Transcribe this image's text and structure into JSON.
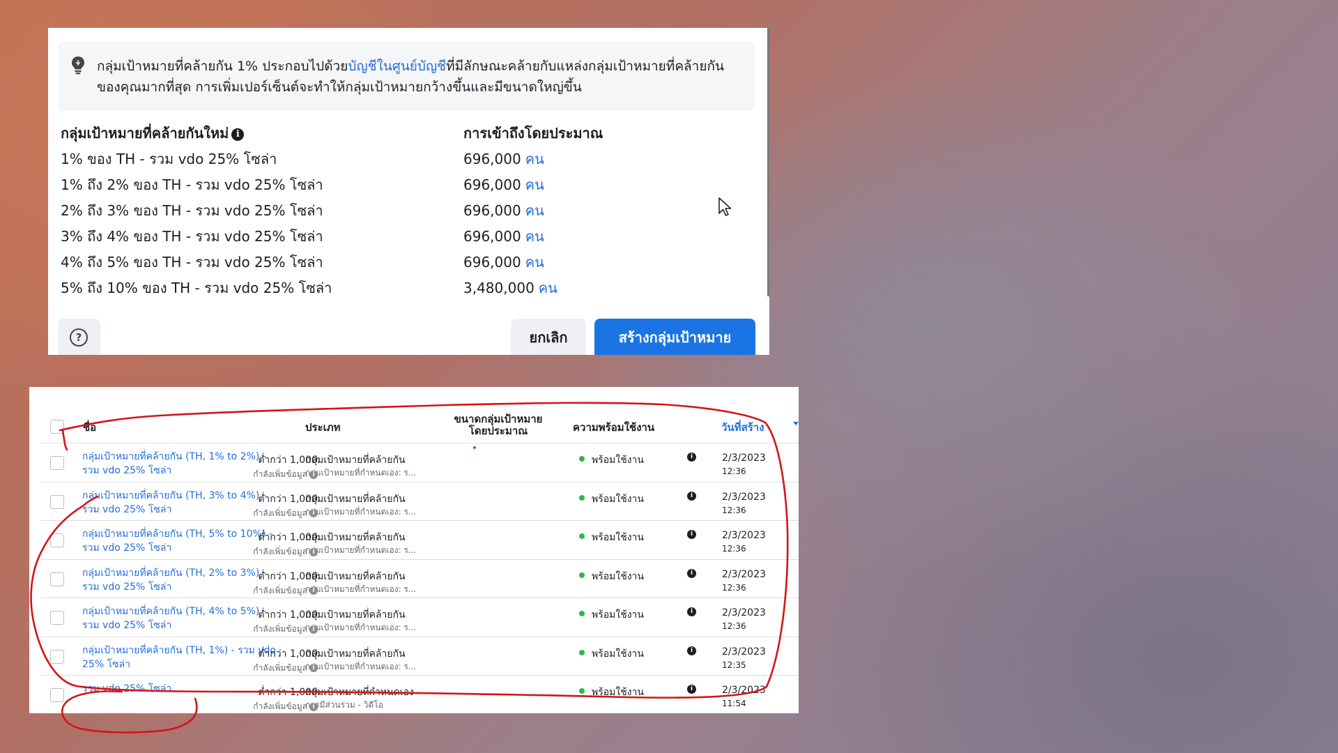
{
  "dialog": {
    "info_text_before": "กลุ่มเป้าหมายที่คล้ายกัน 1% ประกอบไปด้วย",
    "info_text_link": "บัญชีในศูนย์บัญชี",
    "info_text_after": "ที่มีลักษณะคล้ายกับแหล่งกลุ่มเป้าหมายที่คล้ายกันของคุณมากที่สุด การเพิ่มเปอร์เซ็นต์จะทำให้กลุ่มเป้าหมายกว้างขึ้นและมีขนาดใหญ่ขึ้น",
    "col_audience": "กลุ่มเป้าหมายที่คล้ายกันใหม่",
    "col_reach": "การเข้าถึงโดยประมาณ",
    "unit": "คน",
    "rows": [
      {
        "audience": "1% ของ TH - รวม vdo 25% โซล่า",
        "reach": "696,000"
      },
      {
        "audience": "1% ถึง 2% ของ TH - รวม vdo 25% โซล่า",
        "reach": "696,000"
      },
      {
        "audience": "2% ถึง 3% ของ TH - รวม vdo 25% โซล่า",
        "reach": "696,000"
      },
      {
        "audience": "3% ถึง 4% ของ TH - รวม vdo 25% โซล่า",
        "reach": "696,000"
      },
      {
        "audience": "4% ถึง 5% ของ TH - รวม vdo 25% โซล่า",
        "reach": "696,000"
      },
      {
        "audience": "5% ถึง 10% ของ TH - รวม vdo 25% โซล่า",
        "reach": "3,480,000"
      }
    ],
    "help_icon": "?",
    "cancel_label": "ยกเลิก",
    "create_label": "สร้างกลุ่มเป้าหมาย"
  },
  "table": {
    "headers": {
      "name": "ชื่อ",
      "type": "ประเภท",
      "size_line1": "ขนาดกลุ่มเป้าหมาย",
      "size_line2": "โดยประมาณ",
      "availability": "ความพร้อมใช้งาน",
      "created": "วันที่สร้าง"
    },
    "rows": [
      {
        "name": "กลุ่มเป้าหมายที่คล้ายกัน (TH, 1% to 2%) - รวม vdo 25% โซล่า",
        "type": "กลุ่มเป้าหมายที่คล้ายกัน",
        "subtype": "กลุ่มเป้าหมายที่กำหนดเอง: ร...",
        "size": "ต่ำกว่า 1,000",
        "size_note": "กำลังเพิ่มข้อมูล",
        "status": "พร้อมใช้งาน",
        "date": "2/3/2023",
        "time": "12:36"
      },
      {
        "name": "กลุ่มเป้าหมายที่คล้ายกัน (TH, 3% to 4%) - รวม vdo 25% โซล่า",
        "type": "กลุ่มเป้าหมายที่คล้ายกัน",
        "subtype": "กลุ่มเป้าหมายที่กำหนดเอง: ร...",
        "size": "ต่ำกว่า 1,000",
        "size_note": "กำลังเพิ่มข้อมูล",
        "status": "พร้อมใช้งาน",
        "date": "2/3/2023",
        "time": "12:36"
      },
      {
        "name": "กลุ่มเป้าหมายที่คล้ายกัน (TH, 5% to 10%) - รวม vdo 25% โซล่า",
        "type": "กลุ่มเป้าหมายที่คล้ายกัน",
        "subtype": "กลุ่มเป้าหมายที่กำหนดเอง: ร...",
        "size": "ต่ำกว่า 1,000",
        "size_note": "กำลังเพิ่มข้อมูล",
        "status": "พร้อมใช้งาน",
        "date": "2/3/2023",
        "time": "12:36"
      },
      {
        "name": "กลุ่มเป้าหมายที่คล้ายกัน (TH, 2% to 3%) - รวม vdo 25% โซล่า",
        "type": "กลุ่มเป้าหมายที่คล้ายกัน",
        "subtype": "กลุ่มเป้าหมายที่กำหนดเอง: ร...",
        "size": "ต่ำกว่า 1,000",
        "size_note": "กำลังเพิ่มข้อมูล",
        "status": "พร้อมใช้งาน",
        "date": "2/3/2023",
        "time": "12:36"
      },
      {
        "name": "กลุ่มเป้าหมายที่คล้ายกัน (TH, 4% to 5%) - รวม vdo 25% โซล่า",
        "type": "กลุ่มเป้าหมายที่คล้ายกัน",
        "subtype": "กลุ่มเป้าหมายที่กำหนดเอง: ร...",
        "size": "ต่ำกว่า 1,000",
        "size_note": "กำลังเพิ่มข้อมูล",
        "status": "พร้อมใช้งาน",
        "date": "2/3/2023",
        "time": "12:36"
      },
      {
        "name": "กลุ่มเป้าหมายที่คล้ายกัน (TH, 1%) - รวม vdo 25% โซล่า",
        "type": "กลุ่มเป้าหมายที่คล้ายกัน",
        "subtype": "กลุ่มเป้าหมายที่กำหนดเอง: ร...",
        "size": "ต่ำกว่า 1,000",
        "size_note": "กำลังเพิ่มข้อมูล",
        "status": "พร้อมใช้งาน",
        "date": "2/3/2023",
        "time": "12:35"
      },
      {
        "name": "รวม vdo 25% โซล่า",
        "type": "กลุ่มเป้าหมายที่กำหนดเอง",
        "subtype": "การมีส่วนร่วม - วิดีโอ",
        "size": "ต่ำกว่า 1,000",
        "size_note": "กำลังเพิ่มข้อมูล",
        "status": "พร้อมใช้งาน",
        "date": "2/3/2023",
        "time": "11:54"
      }
    ]
  },
  "colors": {
    "link": "#216fdb",
    "primary_button": "#1b74e4",
    "status_ok": "#2bb84a",
    "annotation": "#d41414"
  },
  "icons": {
    "bulb": "lightbulb-icon",
    "info": "info-icon",
    "help": "help-circle-icon",
    "cursor": "mouse-pointer-icon",
    "sort": "sort-down-icon"
  }
}
